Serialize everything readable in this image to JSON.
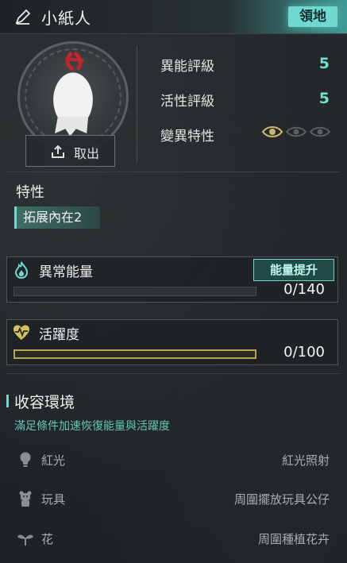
{
  "header": {
    "title": "小紙人",
    "territory_label": "領地"
  },
  "portrait": {
    "take_out_label": "取出"
  },
  "stats": [
    {
      "label": "異能評級",
      "value": "5"
    },
    {
      "label": "活性評級",
      "value": "5"
    },
    {
      "label": "變異特性",
      "eyes_lit": 1,
      "eyes_total": 3
    }
  ],
  "traits": {
    "title": "特性",
    "tag": "拓展內在2"
  },
  "energy": {
    "title": "異常能量",
    "boost_label": "能量提升",
    "value_text": "0/140",
    "fill": 0
  },
  "vitality": {
    "title": "活躍度",
    "value_text": "0/100",
    "fill": 0
  },
  "environment": {
    "title": "收容環境",
    "subtitle": "滿足條件加速恢復能量與活躍度",
    "items": [
      {
        "icon": "bulb-icon",
        "name": "紅光",
        "desc": "紅光照射"
      },
      {
        "icon": "toy-icon",
        "name": "玩具",
        "desc": "周圍擺放玩具公仔"
      },
      {
        "icon": "sprout-icon",
        "name": "花",
        "desc": "周圍種植花卉"
      }
    ]
  },
  "colors": {
    "accent": "#6fd8cf",
    "stat_value": "#6fe0d0",
    "vitality_border": "#b8a352"
  }
}
